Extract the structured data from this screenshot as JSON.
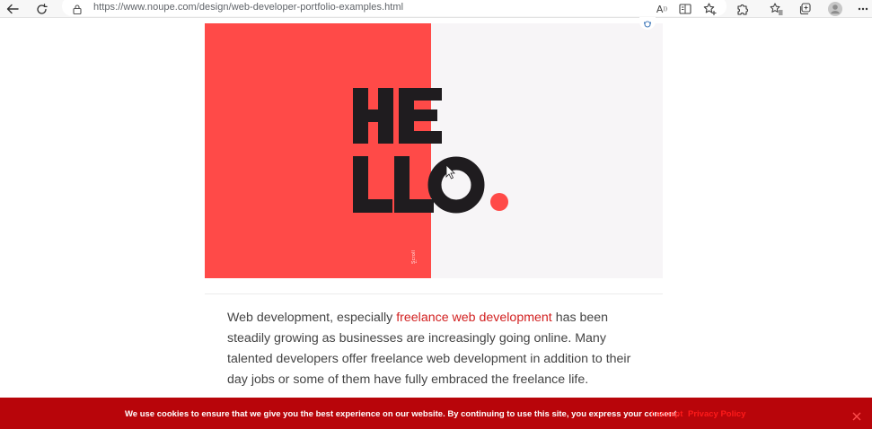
{
  "browser": {
    "url": "https://www.noupe.com/design/web-developer-portfolio-examples.html",
    "read_aloud_icon": "read-aloud-icon",
    "icons": [
      "back-arrow-icon",
      "reload-icon",
      "lock-icon",
      "read-aloud-icon",
      "immersive-reader-icon",
      "add-favorite-icon",
      "extensions-icon",
      "favorites-icon",
      "collections-icon",
      "profile-avatar",
      "more-options-icon"
    ]
  },
  "hero": {
    "line1": "HE",
    "line2": "LLO",
    "dot_color": "#ff4a48",
    "scroll_label": "Scroll",
    "colors": {
      "left_panel": "#ff4a48",
      "right_panel": "#f7f5f7",
      "text": "#1f1c1f"
    }
  },
  "article": {
    "text_before_link": "Web development, especially ",
    "link_text": "freelance web development",
    "text_after_link": " has been steadily growing as businesses are increasingly going online. Many talented developers offer freelance web development in addition to their day jobs or some of them have fully embraced the freelance life."
  },
  "cookie_bar": {
    "message": "We use cookies to ensure that we give you the best experience on our website. By continuing to use this site, you express your consent.",
    "accept_label": "I accept",
    "policy_label": "Privacy Policy",
    "colors": {
      "background": "#b8050a",
      "links": "#ff1a1a"
    }
  }
}
